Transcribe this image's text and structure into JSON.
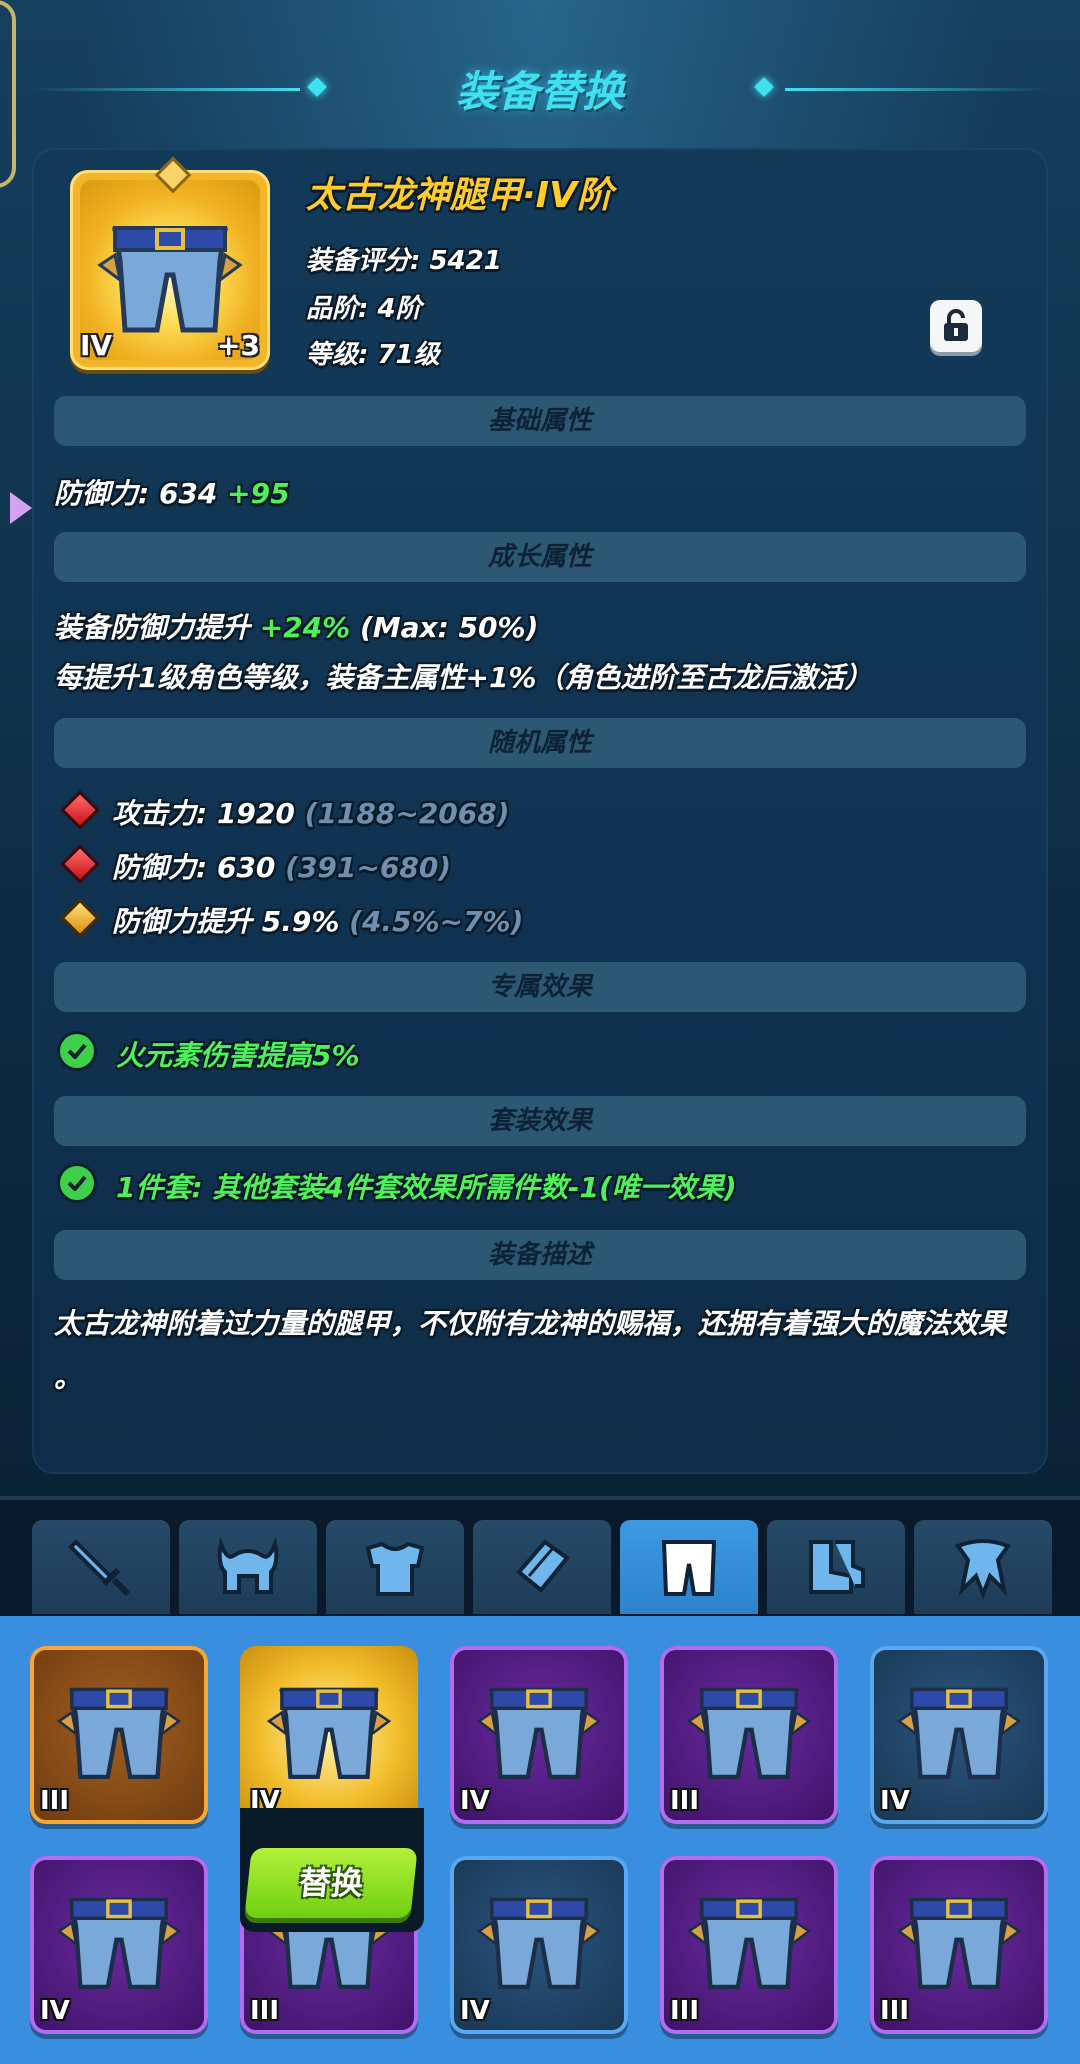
{
  "header": {
    "title": "装备替换"
  },
  "item": {
    "name": "太古龙神腿甲·IV阶",
    "score": "装备评分: 5421",
    "grade": "品阶: 4阶",
    "level": "等级: 71级",
    "tier_roman": "IV",
    "enhance": "+3"
  },
  "sections": {
    "basic": "基础属性",
    "growth": "成长属性",
    "random": "随机属性",
    "exclusive": "专属效果",
    "set": "套装效果",
    "desc": "装备描述"
  },
  "basic_stats": {
    "label": "防御力: 634",
    "bonus": "+95"
  },
  "growth_stats": {
    "line1_prefix": "装备防御力提升 ",
    "line1_value": "+24%",
    "line1_suffix": " (Max: 50%)",
    "line2": "每提升1级角色等级，装备主属性+1%（角色进阶至古龙后激活）"
  },
  "random_stats": [
    {
      "text": "攻击力: 1920",
      "range": "(1188~2068)",
      "gem": "red"
    },
    {
      "text": "防御力: 630",
      "range": "(391~680)",
      "gem": "red"
    },
    {
      "text": "防御力提升 5.9%",
      "range": "(4.5%~7%)",
      "gem": "gold"
    }
  ],
  "exclusive_effect": "火元素伤害提高5%",
  "set_effect": "1件套: 其他套装4件套效果所需件数-1(唯一效果)",
  "description_line1": "太古龙神附着过力量的腿甲，不仅附有龙神的赐福，还拥有着强大的魔法效果",
  "description_line2": "。",
  "tabs": [
    "sword-icon",
    "helmet-icon",
    "armor-icon",
    "bracer-icon",
    "pants-icon",
    "boots-icon",
    "amulet-icon"
  ],
  "active_tab": 4,
  "grid": [
    {
      "rarity": "orange",
      "level": "III"
    },
    {
      "rarity": "gold",
      "level": "IV"
    },
    {
      "rarity": "purple",
      "level": "IV"
    },
    {
      "rarity": "purple",
      "level": "III"
    },
    {
      "rarity": "blue",
      "level": "IV"
    },
    {
      "rarity": "purple",
      "level": "IV"
    },
    {
      "rarity": "purple",
      "level": "III"
    },
    {
      "rarity": "blue",
      "level": "IV"
    },
    {
      "rarity": "purple",
      "level": "III"
    },
    {
      "rarity": "purple",
      "level": "III"
    }
  ],
  "replace_button": "替换",
  "colors": {
    "accent": "#3fe0f0",
    "gold": "#ffcc2a",
    "green": "#4ff05a"
  }
}
